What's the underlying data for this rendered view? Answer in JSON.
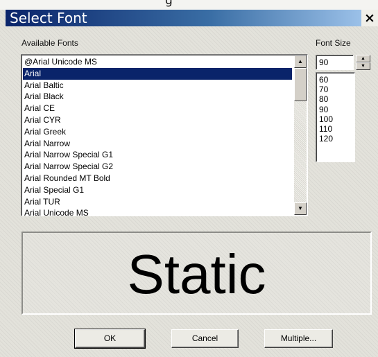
{
  "window": {
    "title_behind": "g",
    "title": "Select Font",
    "close_label": "×"
  },
  "fonts": {
    "label": "Available Fonts",
    "items": [
      {
        "label": "@Arial Unicode MS",
        "selected": false
      },
      {
        "label": "Arial",
        "selected": true
      },
      {
        "label": "Arial Baltic",
        "selected": false
      },
      {
        "label": "Arial Black",
        "selected": false
      },
      {
        "label": "Arial CE",
        "selected": false
      },
      {
        "label": "Arial CYR",
        "selected": false
      },
      {
        "label": "Arial Greek",
        "selected": false
      },
      {
        "label": "Arial Narrow",
        "selected": false
      },
      {
        "label": "Arial Narrow Special G1",
        "selected": false
      },
      {
        "label": "Arial Narrow Special G2",
        "selected": false
      },
      {
        "label": "Arial Rounded MT Bold",
        "selected": false
      },
      {
        "label": "Arial Special G1",
        "selected": false
      },
      {
        "label": "Arial TUR",
        "selected": false
      },
      {
        "label": "Arial Unicode MS",
        "selected": false
      }
    ]
  },
  "size": {
    "label": "Font Size",
    "value": "90",
    "options": [
      "60",
      "70",
      "80",
      "90",
      "100",
      "110",
      "120"
    ]
  },
  "preview": {
    "text": "Static"
  },
  "buttons": {
    "ok": "OK",
    "cancel": "Cancel",
    "multiple": "Multiple..."
  },
  "icons": {
    "scroll_up": "arrow-up-icon",
    "scroll_down": "arrow-down-icon",
    "spin_up": "arrow-up-icon",
    "spin_down": "arrow-down-icon"
  }
}
